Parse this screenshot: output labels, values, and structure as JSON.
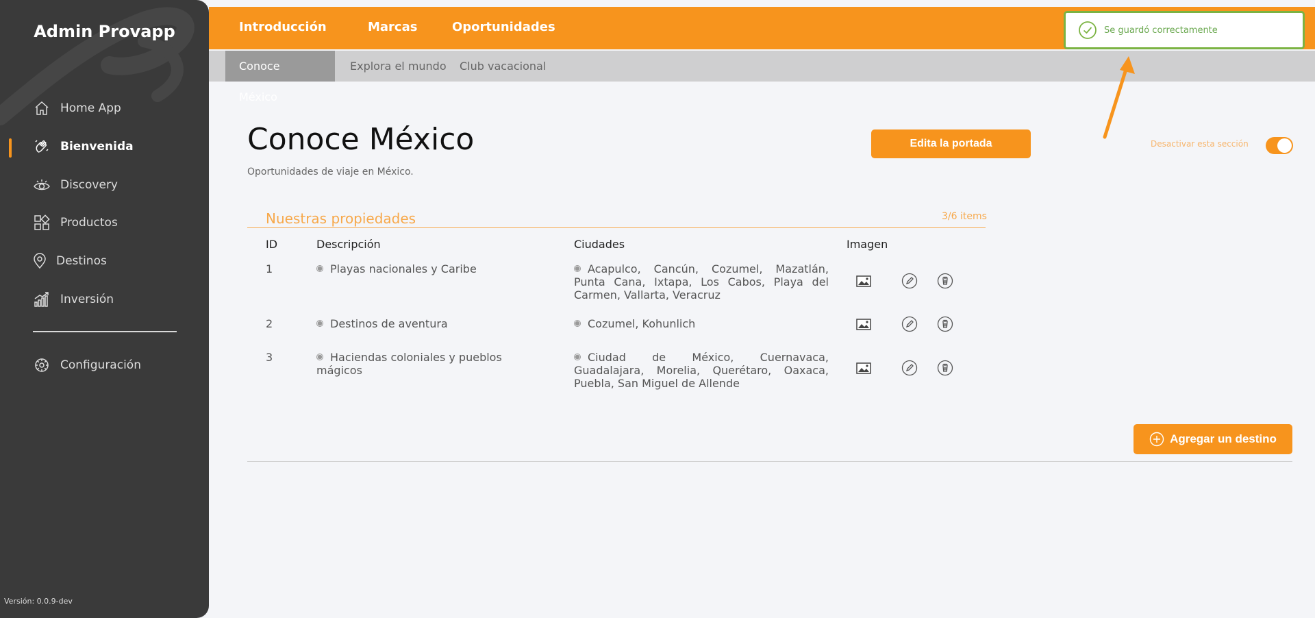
{
  "sidebar": {
    "brand": "Admin Provapp",
    "items": [
      {
        "label": "Home App",
        "icon": "home-icon"
      },
      {
        "label": "Bienvenida",
        "icon": "waving-hand-icon"
      },
      {
        "label": "Discovery",
        "icon": "eye-icon"
      },
      {
        "label": "Productos",
        "icon": "grid-icon"
      },
      {
        "label": "Destinos",
        "icon": "map-pin-icon"
      },
      {
        "label": "Inversión",
        "icon": "chart-icon"
      }
    ],
    "settings": {
      "label": "Configuración",
      "icon": "gear-icon"
    },
    "version": "Versión: 0.0.9-dev",
    "active_index": 1
  },
  "topnav": {
    "tabs": [
      "Introducción",
      "Marcas",
      "Oportunidades"
    ]
  },
  "subnav": {
    "tabs": [
      "Conoce México",
      "Explora el mundo",
      "Club vacacional"
    ]
  },
  "page": {
    "title": "Conoce México",
    "subtitle": "Oportunidades de viaje en México.",
    "edit_cover_label": "Edita la portada",
    "toggle_label": "Desactivar esta sección",
    "toggle_on": true
  },
  "section": {
    "title": "Nuestras propiedades",
    "count": "3/6 items",
    "columns": [
      "ID",
      "Descripción",
      "Ciudades",
      "Imagen"
    ],
    "rows": [
      {
        "id": "1",
        "description": "Playas nacionales y Caribe",
        "cities": "Acapulco, Cancún, Cozumel, Mazatlán, Punta Cana, Ixtapa, Los Cabos, Playa del Carmen, Vallarta, Veracruz"
      },
      {
        "id": "2",
        "description": "Destinos de aventura",
        "cities": "Cozumel, Kohunlich"
      },
      {
        "id": "3",
        "description": "Haciendas coloniales y pueblos mágicos",
        "cities": "Ciudad de México, Cuernavaca, Guadalajara, Morelia, Querétaro, Oaxaca, Puebla, San Miguel de Allende"
      }
    ],
    "add_label": "Agregar un destino"
  },
  "toast": {
    "message": "Se guardó correctamente"
  },
  "colors": {
    "accent": "#f7941d",
    "sidebar": "#3a3a3a",
    "success": "#7bb342"
  }
}
